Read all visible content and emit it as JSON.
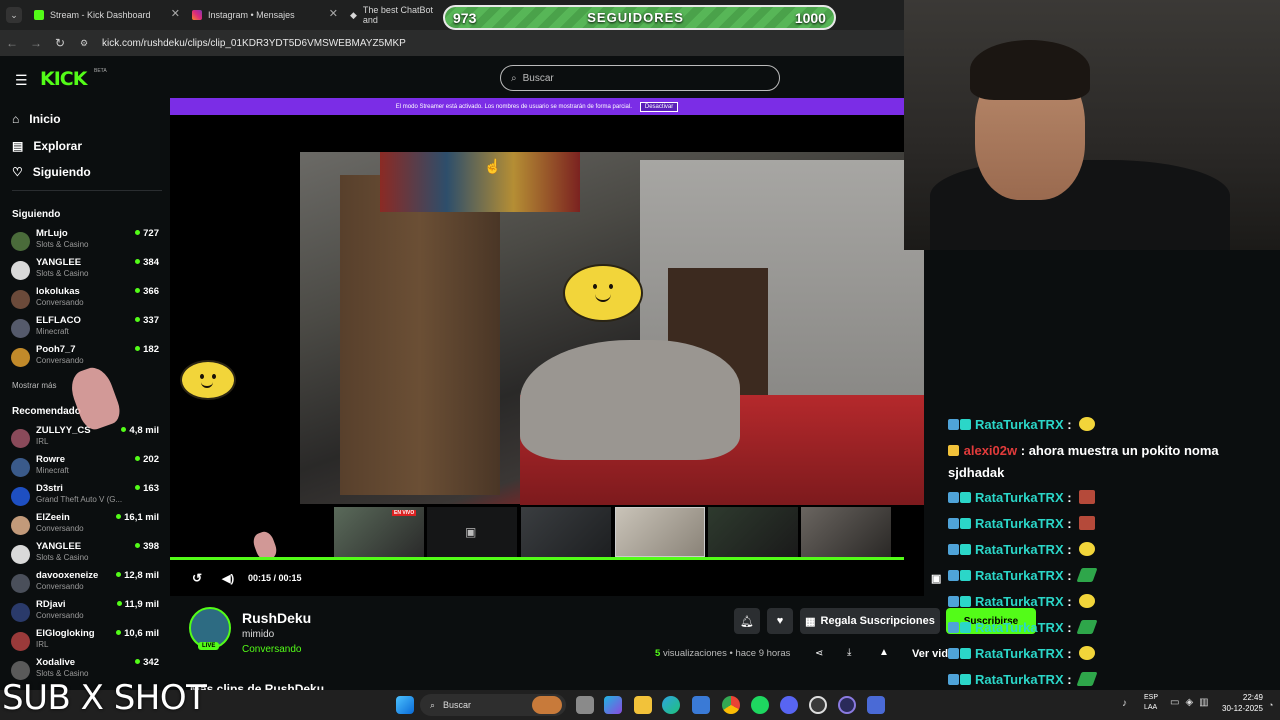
{
  "browser": {
    "tabs": [
      {
        "label": "Stream - Kick Dashboard",
        "color": "#53fc18"
      },
      {
        "label": "Instagram • Mensajes",
        "color": "#e1306c"
      },
      {
        "label": "The best ChatBot and",
        "color": "#ffffff"
      }
    ],
    "url": "kick.com/rushdeku/clips/clip_01KDR3YDT5D6VMSWEBMAYZ5MKP"
  },
  "header": {
    "logo": "KICK",
    "beta": "BETA",
    "search_placeholder": "Buscar"
  },
  "sidebar": {
    "nav": [
      {
        "label": "Inicio",
        "icon": "home-icon"
      },
      {
        "label": "Explorar",
        "icon": "compass-icon"
      },
      {
        "label": "Siguiendo",
        "icon": "heart-icon"
      }
    ],
    "following_title": "Siguiendo",
    "following": [
      {
        "name": "MrLujo",
        "category": "Slots & Casino",
        "viewers": "727"
      },
      {
        "name": "YANGLEE",
        "category": "Slots & Casino",
        "viewers": "384"
      },
      {
        "name": "lokolukas",
        "category": "Conversando",
        "viewers": "366"
      },
      {
        "name": "ELFLACO",
        "category": "Minecraft",
        "viewers": "337"
      },
      {
        "name": "Pooh7_7",
        "category": "Conversando",
        "viewers": "182"
      }
    ],
    "show_more": "Mostrar más",
    "recommended_title": "Recomendado",
    "recommended": [
      {
        "name": "ZULLYY_CS",
        "category": "IRL",
        "viewers": "4,8 mil"
      },
      {
        "name": "Rowre",
        "category": "Minecraft",
        "viewers": "202"
      },
      {
        "name": "D3stri",
        "category": "Grand Theft Auto V (G...",
        "viewers": "163"
      },
      {
        "name": "ElZeein",
        "category": "Conversando",
        "viewers": "16,1 mil"
      },
      {
        "name": "YANGLEE",
        "category": "Slots & Casino",
        "viewers": "398"
      },
      {
        "name": "davooxeneize",
        "category": "Conversando",
        "viewers": "12,8 mil"
      },
      {
        "name": "RDjavi",
        "category": "Conversando",
        "viewers": "11,9 mil"
      },
      {
        "name": "ElGlogloking",
        "category": "IRL",
        "viewers": "10,6 mil"
      },
      {
        "name": "Xodalive",
        "category": "Slots & Casino",
        "viewers": "342"
      }
    ]
  },
  "streamer_mode": {
    "text": "El modo Streamer está activado. Los nombres de usuario se mostrarán de forma parcial.",
    "button": "Desactivar"
  },
  "player": {
    "time": "00:15 / 00:15",
    "progress": 1.0,
    "thumb_badge": "EN VIVO"
  },
  "channel": {
    "name": "RushDeku",
    "clip_title": "mimido",
    "category": "Conversando",
    "live": "LIVE",
    "gift_label": "Regala Suscripciones",
    "subscribe_label": "Suscribirse",
    "views_count": "5",
    "views_text": "visualizaciones",
    "time_ago": "hace 9 horas",
    "watch_label": "Ver vid",
    "more_clips": "Más clips de RushDeku"
  },
  "goal": {
    "current": "973",
    "label": "SEGUIDORES",
    "target": "1000"
  },
  "chat": [
    {
      "user": "RataTurkaTRX",
      "color": "#2bd6c8",
      "text": "",
      "emote": "yellow"
    },
    {
      "user": "alexi02w",
      "color": "#e23b3b",
      "text": "ahora muestra un pokito noma sjdhadak",
      "emote": ""
    },
    {
      "user": "RataTurkaTRX",
      "color": "#2bd6c8",
      "text": "",
      "emote": "red"
    },
    {
      "user": "RataTurkaTRX",
      "color": "#2bd6c8",
      "text": "",
      "emote": "red"
    },
    {
      "user": "RataTurkaTRX",
      "color": "#2bd6c8",
      "text": "",
      "emote": "yellow"
    },
    {
      "user": "RataTurkaTRX",
      "color": "#2bd6c8",
      "text": "",
      "emote": "green"
    },
    {
      "user": "RataTurkaTRX",
      "color": "#2bd6c8",
      "text": "",
      "emote": "yellow"
    },
    {
      "user": "RataTurkaTRX",
      "color": "#2bd6c8",
      "text": "",
      "emote": "green"
    },
    {
      "user": "RataTurkaTRX",
      "color": "#2bd6c8",
      "text": "",
      "emote": "yellow"
    },
    {
      "user": "RataTurkaTRX",
      "color": "#2bd6c8",
      "text": "",
      "emote": "green"
    },
    {
      "user": "RataTurkaTRX",
      "color": "#2bd6c8",
      "text": "",
      "emote": "yellow"
    }
  ],
  "taskbar": {
    "search": "Buscar",
    "lang_top": "ESP",
    "lang_bottom": "LAA",
    "time": "22:49",
    "date": "30-12-2025"
  },
  "overlay_text": "SUB X SHOT",
  "accent": "#53fc18"
}
